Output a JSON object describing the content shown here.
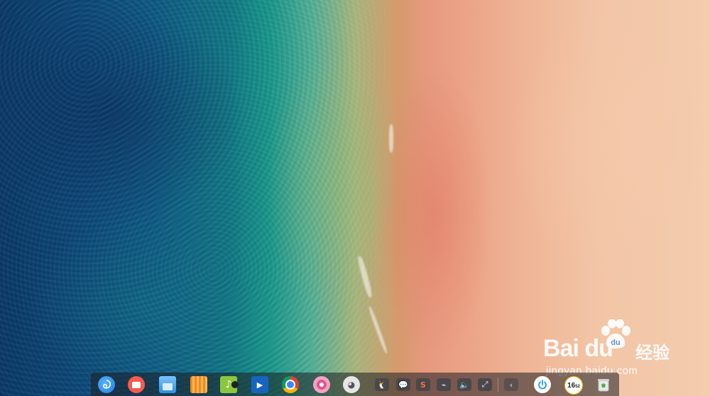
{
  "desktop": {
    "wallpaper": "beach-aerial-wallpaper"
  },
  "watermark": {
    "brand": "Bai du",
    "brand_cn": "经验",
    "url": "jingyan.baidu.com"
  },
  "dock": {
    "apps": [
      {
        "name": "launcher-icon",
        "color": "#1e7fd9"
      },
      {
        "name": "multitasking-icon",
        "color": "#f45a4f"
      },
      {
        "name": "file-manager-icon",
        "color": "#42a5f5"
      },
      {
        "name": "app-store-icon",
        "color": "#f08a1c"
      },
      {
        "name": "music-icon",
        "color": "#8cc63f"
      },
      {
        "name": "video-icon",
        "color": "#1565c0"
      },
      {
        "name": "chrome-icon",
        "color": "#db4437"
      },
      {
        "name": "settings-icon",
        "color": "#e0568f"
      },
      {
        "name": "cat-avatar-icon",
        "color": "#e6e6e6"
      }
    ],
    "tray": [
      {
        "name": "qq-icon",
        "glyph": "🐧"
      },
      {
        "name": "wechat-icon",
        "glyph": "💬"
      },
      {
        "name": "sogou-input-icon",
        "glyph": "S"
      },
      {
        "name": "usb-icon",
        "glyph": "⌁"
      },
      {
        "name": "volume-icon",
        "glyph": "🔈"
      },
      {
        "name": "network-icon",
        "glyph": "⤢"
      },
      {
        "name": "collapse-tray-icon",
        "glyph": "‹"
      }
    ],
    "power_icon": "power-icon",
    "clock": {
      "hours": "16",
      "minutes": "52"
    },
    "trash_icon": "trash-icon"
  }
}
